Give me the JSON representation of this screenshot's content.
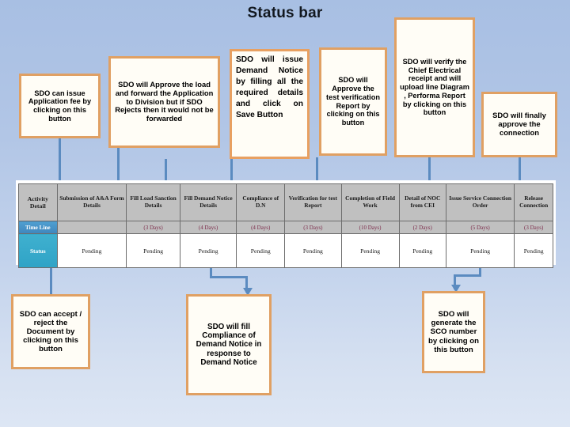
{
  "title": "Status bar",
  "theme": {
    "background_top": "#a8bfe3",
    "background_bottom": "#dde6f4",
    "callout_border": "#e0a063",
    "callout_fill": "#fffdf6",
    "connector": "#5b8bc0",
    "header_fill": "#c0c0c0",
    "timeline_label_fill": "#3f86bd",
    "status_label_fill": "#2fa3c6",
    "timeline_text": "#7c2b4a"
  },
  "callouts": [
    {
      "id": "issue-application-fee",
      "text": "SDO  can issue Application fee by clicking on this button"
    },
    {
      "id": "approve-load-forward",
      "text": "SDO  will Approve the load and forward the Application to Division but if SDO Rejects then it would not be forwarded"
    },
    {
      "id": "issue-demand-notice",
      "text": "SDO will issue Demand Notice by filling all the required details and click on Save Button"
    },
    {
      "id": "approve-test-report",
      "text": "SDO  will Approve the test verification Report  by clicking on this button"
    },
    {
      "id": "verify-cei-receipt",
      "text": "SDO  will verify the Chief Electrical receipt  and will upload line Diagram , Performa Report by clicking on this button"
    },
    {
      "id": "finally-approve",
      "text": "SDO will finally approve the connection"
    },
    {
      "id": "accept-reject-document",
      "text": "SDO  can accept / reject the Document by clicking on this button"
    },
    {
      "id": "fill-compliance-dn",
      "text": "SDO will fill Compliance of Demand Notice in response to Demand Notice"
    },
    {
      "id": "generate-sco-number",
      "text": "SDO will generate the SCO number by clicking on this button"
    }
  ],
  "table": {
    "row_labels": {
      "activity": "Activity Detail",
      "timeline": "Time Line",
      "status": "Status"
    },
    "columns": [
      {
        "header": "Submission of A&A Form Details",
        "timeline": "",
        "status": "Pending"
      },
      {
        "header": "Fill Load Sanction Details",
        "timeline": "(3 Days)",
        "status": "Pending"
      },
      {
        "header": "Fill Demand Notice Details",
        "timeline": "(4 Days)",
        "status": "Pending"
      },
      {
        "header": "Compliance of D.N",
        "timeline": "(4 Days)",
        "status": "Pending"
      },
      {
        "header": "Verification for test Report",
        "timeline": "(3 Days)",
        "status": "Pending"
      },
      {
        "header": "Completion of Field Work",
        "timeline": "(10 Days)",
        "status": "Pending"
      },
      {
        "header": "Detail of NOC from CEI",
        "timeline": "(2 Days)",
        "status": "Pending"
      },
      {
        "header": "Issue Service Connection Order",
        "timeline": "(5 Days)",
        "status": "Pending"
      },
      {
        "header": "Release Connection",
        "timeline": "(3 Days)",
        "status": "Pending"
      }
    ]
  }
}
